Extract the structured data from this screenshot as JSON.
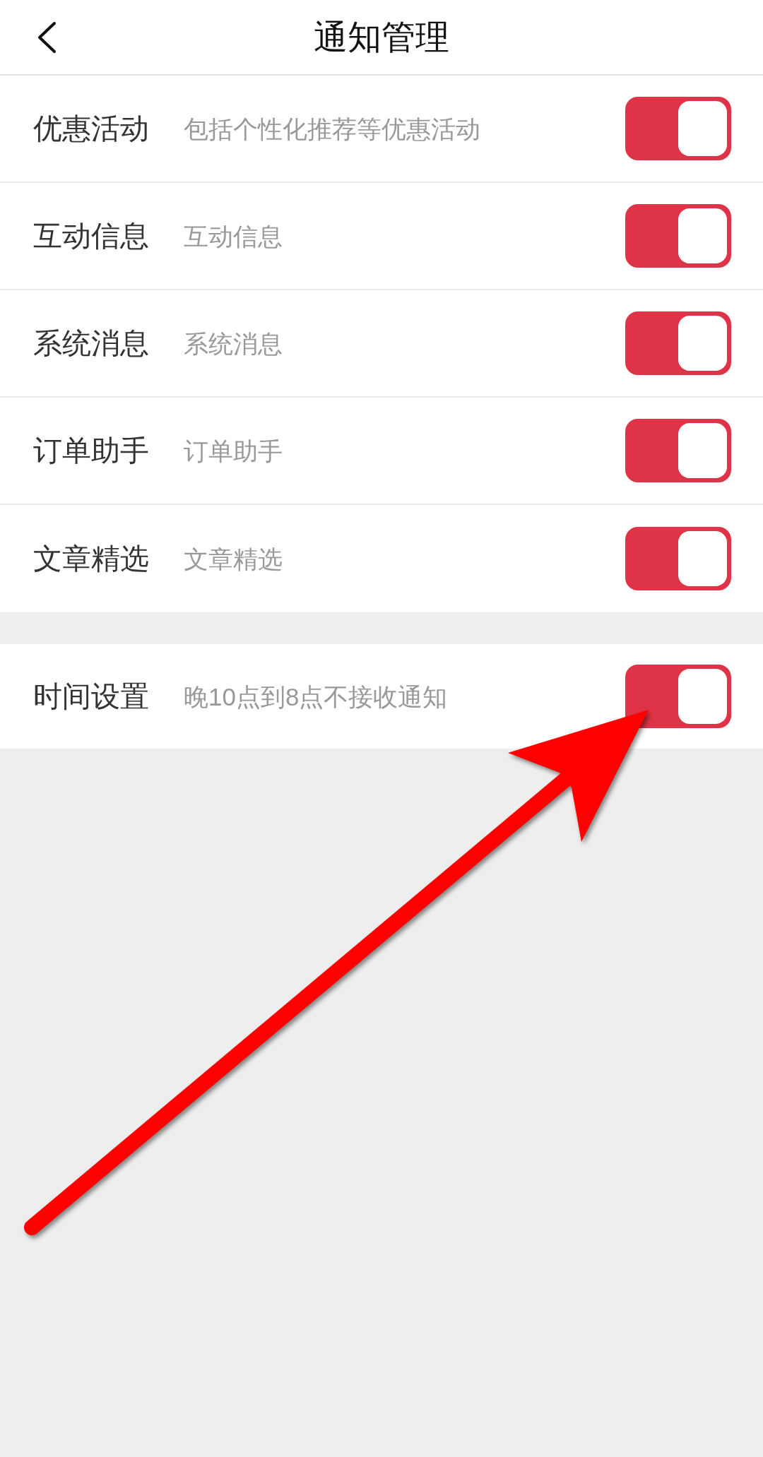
{
  "header": {
    "title": "通知管理"
  },
  "settings": [
    {
      "label": "优惠活动",
      "description": "包括个性化推荐等优惠活动",
      "on": true
    },
    {
      "label": "互动信息",
      "description": "互动信息",
      "on": true
    },
    {
      "label": "系统消息",
      "description": "系统消息",
      "on": true
    },
    {
      "label": "订单助手",
      "description": "订单助手",
      "on": true
    },
    {
      "label": "文章精选",
      "description": "文章精选",
      "on": true
    }
  ],
  "time_setting": {
    "label": "时间设置",
    "description": "晚10点到8点不接收通知",
    "on": true
  }
}
